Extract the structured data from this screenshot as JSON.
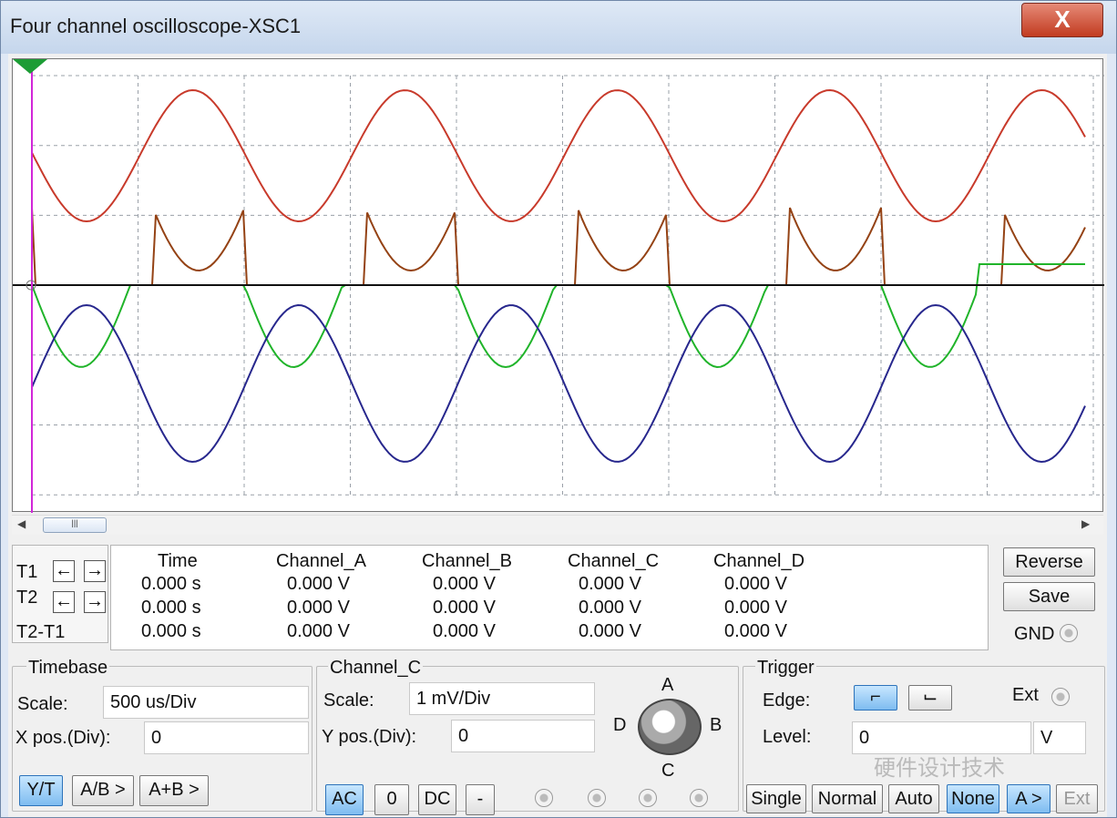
{
  "window": {
    "title": "Four channel oscilloscope-XSC1",
    "close_label": "X"
  },
  "measurements": {
    "columns": [
      "Time",
      "Channel_A",
      "Channel_B",
      "Channel_C",
      "Channel_D"
    ],
    "rows": [
      {
        "label": "T1",
        "values": [
          "0.000 s",
          "0.000 V",
          "0.000 V",
          "0.000 V",
          "0.000 V"
        ]
      },
      {
        "label": "T2",
        "values": [
          "0.000 s",
          "0.000 V",
          "0.000 V",
          "0.000 V",
          "0.000 V"
        ]
      },
      {
        "label": "T2-T1",
        "values": [
          "0.000 s",
          "0.000 V",
          "0.000 V",
          "0.000 V",
          "0.000 V"
        ]
      }
    ]
  },
  "buttons": {
    "reverse": "Reverse",
    "save": "Save",
    "gnd": "GND"
  },
  "timebase": {
    "title": "Timebase",
    "scale_label": "Scale:",
    "scale_value": "500 us/Div",
    "xpos_label": "X pos.(Div):",
    "xpos_value": "0",
    "modes": [
      "Y/T",
      "A/B >",
      "A+B >"
    ]
  },
  "channel": {
    "title": "Channel_C",
    "scale_label": "Scale:",
    "scale_value": "1 mV/Div",
    "ypos_label": "Y pos.(Div):",
    "ypos_value": "0",
    "coupling": [
      "AC",
      "0",
      "DC",
      "-"
    ],
    "knob_labels": {
      "a": "A",
      "b": "B",
      "c": "C",
      "d": "D"
    }
  },
  "trigger": {
    "title": "Trigger",
    "edge_label": "Edge:",
    "level_label": "Level:",
    "level_value": "0",
    "level_unit": "V",
    "ext_label": "Ext",
    "modes": [
      "Single",
      "Normal",
      "Auto",
      "None",
      "A >",
      "Ext"
    ]
  },
  "watermark": "硬件设计技术",
  "colors": {
    "channel_a": "#c83a2b",
    "channel_b": "#944214",
    "channel_c": "#20b42a",
    "channel_d": "#27278d",
    "grid": "#9aa0a8",
    "cursor": "#d126d9"
  }
}
